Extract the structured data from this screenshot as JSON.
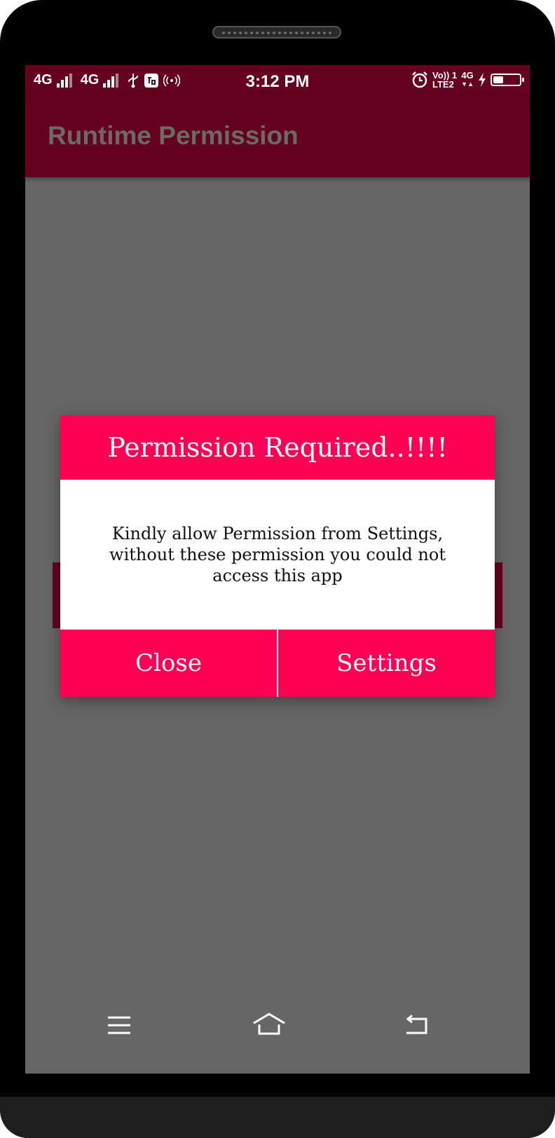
{
  "status_bar": {
    "sim1": "4G",
    "sim2": "4G",
    "time": "3:12 PM",
    "volte": "Vo)) 1",
    "lte": "LTE2",
    "net": "4G",
    "battery_level": 0.45
  },
  "app_bar": {
    "title": "Runtime Permission"
  },
  "dialog": {
    "title": "Permission Required..!!!!",
    "message": "Kindly allow Permission from Settings, without these permission you could not access this app",
    "close_label": "Close",
    "settings_label": "Settings"
  },
  "colors": {
    "primary_dark": "#660020",
    "accent": "#ff0055",
    "scrim": "#666666"
  },
  "icons": [
    "signal-icon",
    "usb-icon",
    "notification-icon",
    "hotspot-icon",
    "alarm-icon",
    "battery-icon",
    "charging-icon",
    "menu-icon",
    "home-icon",
    "back-icon"
  ]
}
